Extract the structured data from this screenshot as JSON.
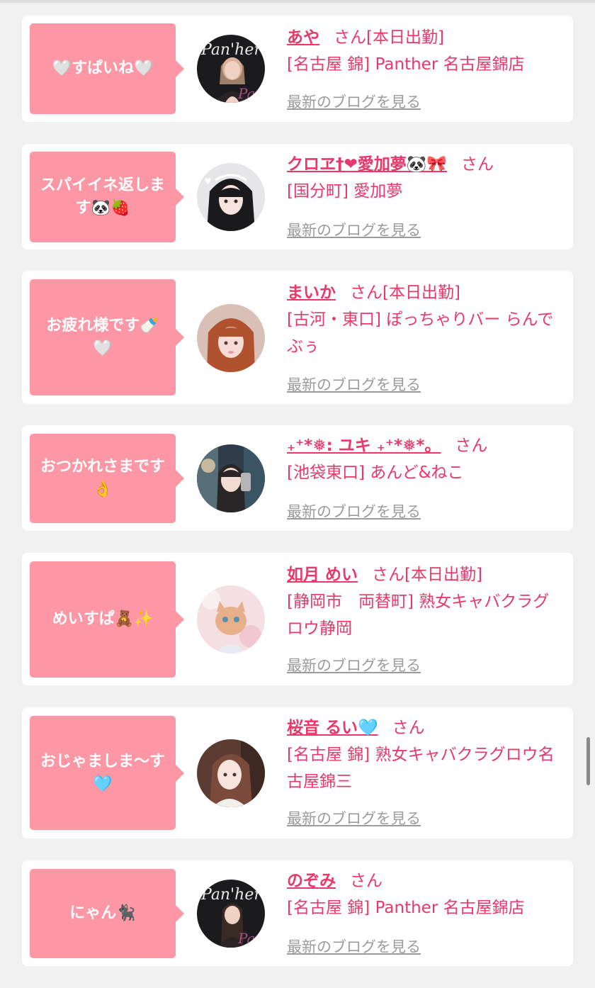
{
  "suffix_san": "さん",
  "blog_link_label": "最新のブログを見る",
  "colors": {
    "background": "#f1f1f1",
    "card": "#ffffff",
    "bubble": "#fd97a6",
    "name": "#e8396a",
    "blog_link": "#9b9b9b"
  },
  "entries": [
    {
      "bubble_text": "🤍すぱいね🤍",
      "name": "あや",
      "status": "[本日出勤]",
      "shop": "[名古屋 錦] Panther 名古屋錦店"
    },
    {
      "bubble_text": "スパイイネ返しま す🐼🍓",
      "name": "クロヱ†❤愛加夢🐼🎀",
      "status": "",
      "shop": "[国分町] 愛加夢"
    },
    {
      "bubble_text": "お疲れ様です🍼 🤍",
      "name": "まいか",
      "status": "[本日出勤]",
      "shop": "[古河・東口] ぽっちゃりバー らんでぶぅ"
    },
    {
      "bubble_text": "おつかれさまです 👌",
      "name": "₊⁺*❅: ユキ ₊⁺*❅*。",
      "status": "",
      "shop": "[池袋東口] あんど&ねこ"
    },
    {
      "bubble_text": "めいすぱ🧸✨",
      "name": "如月 めい",
      "status": "[本日出勤]",
      "shop": "[静岡市　両替町] 熟女キャバクラグロウ静岡"
    },
    {
      "bubble_text": "おじゃましま〜す 🩵",
      "name": "桜音 るい🩵",
      "status": "",
      "shop": "[名古屋 錦] 熟女キャバクラグロウ名古屋錦三"
    },
    {
      "bubble_text": "にゃん🐈‍⬛",
      "name": "のぞみ",
      "status": "",
      "shop": "[名古屋 錦] Panther 名古屋錦店"
    }
  ]
}
